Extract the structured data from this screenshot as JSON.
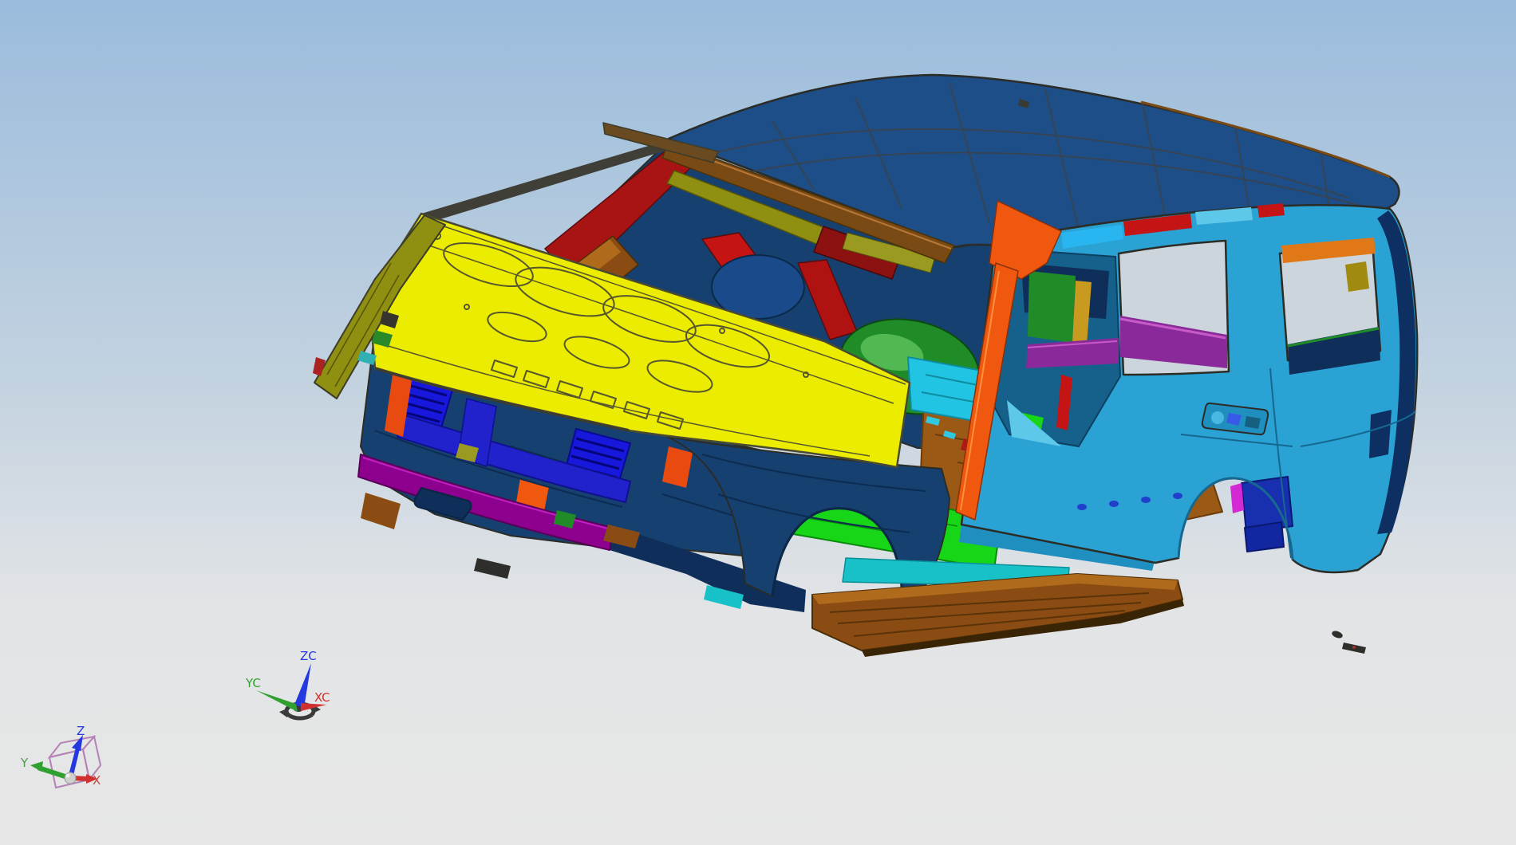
{
  "app": {
    "view_type": "cad-3d-viewport",
    "model_subject": "vehicle body-in-white assembly"
  },
  "palette": {
    "background_top": "#9abcdc",
    "background_mid": "#c3d2e0",
    "background_low": "#e2e4e6",
    "background_bottom": "#e7e7e7",
    "edge": "#44443c",
    "hood_yellow": "#ecec00",
    "roof_blue": "#1d4e88",
    "roof_line": "#39434c",
    "body_cyan": "#2aa2d4",
    "body_cyan_dark": "#1f8fc0",
    "body_cyan_light": "#5ec8ea",
    "aperture_blue": "#16608c",
    "navy": "#16406f",
    "navy_dark": "#0f2f5a",
    "navy_inner": "#0e2f62",
    "navy_box": "#1830b0",
    "navy_box2": "#1226a0",
    "seat_navy": "#1a4a8a",
    "grille_blue": "#1818dc",
    "bar_blue": "#2222cc",
    "dot_blue": "#2040cc",
    "glyph_blue": "#3858e8",
    "magenta": "#c428c4",
    "magenta_bright": "#d428d4",
    "magenta_light": "#c85ac8",
    "purple_bar": "#8e008e",
    "purple_shelf": "#8a2a9a",
    "orange": "#f05810",
    "orange_red": "#e84a10",
    "orange_bracket": "#e07818",
    "red": "#c41414",
    "red_dark": "#b01212",
    "red_floor": "#b01818",
    "crimson": "#a81414",
    "maroon": "#8c1212",
    "green_bright": "#17d617",
    "green_mid": "#1f8c28",
    "green_light": "#52b852",
    "teal": "#18c0c8",
    "cyan_floor": "#22c4e4",
    "cyan_speck": "#30c8e0",
    "olive": "#8f8f12",
    "olive2": "#9a9a20",
    "olive_tab": "#a08a10",
    "gold_strip": "#c89a20",
    "brown": "#8a4c12",
    "brown_light": "#b06a1c",
    "brown_header": "#7a4a14",
    "brown_flap": "#6a4a20",
    "brown_floor": "#9a5a16",
    "rocker_shadow": "#3a2406",
    "sky_accent": "#29b6f0",
    "pale_green": "#a0d8a0",
    "window_bg": "#ccd5dc",
    "axis_red": "#d03030",
    "axis_green": "#30a030",
    "axis_blue": "#2438e0",
    "label_red_soft": "#c04848",
    "label_green_soft": "#4a9a4a",
    "wcs_dark": "#3a3a3a",
    "cube_purple": "#b482b4",
    "sphere_gray": "#d0d0d0",
    "debris_dark": "#2e2e2a"
  },
  "wcs_triad": {
    "x_label": "XC",
    "y_label": "YC",
    "z_label": "ZC"
  },
  "axis_triad": {
    "x_label": "X",
    "y_label": "Y",
    "z_label": "Z"
  }
}
